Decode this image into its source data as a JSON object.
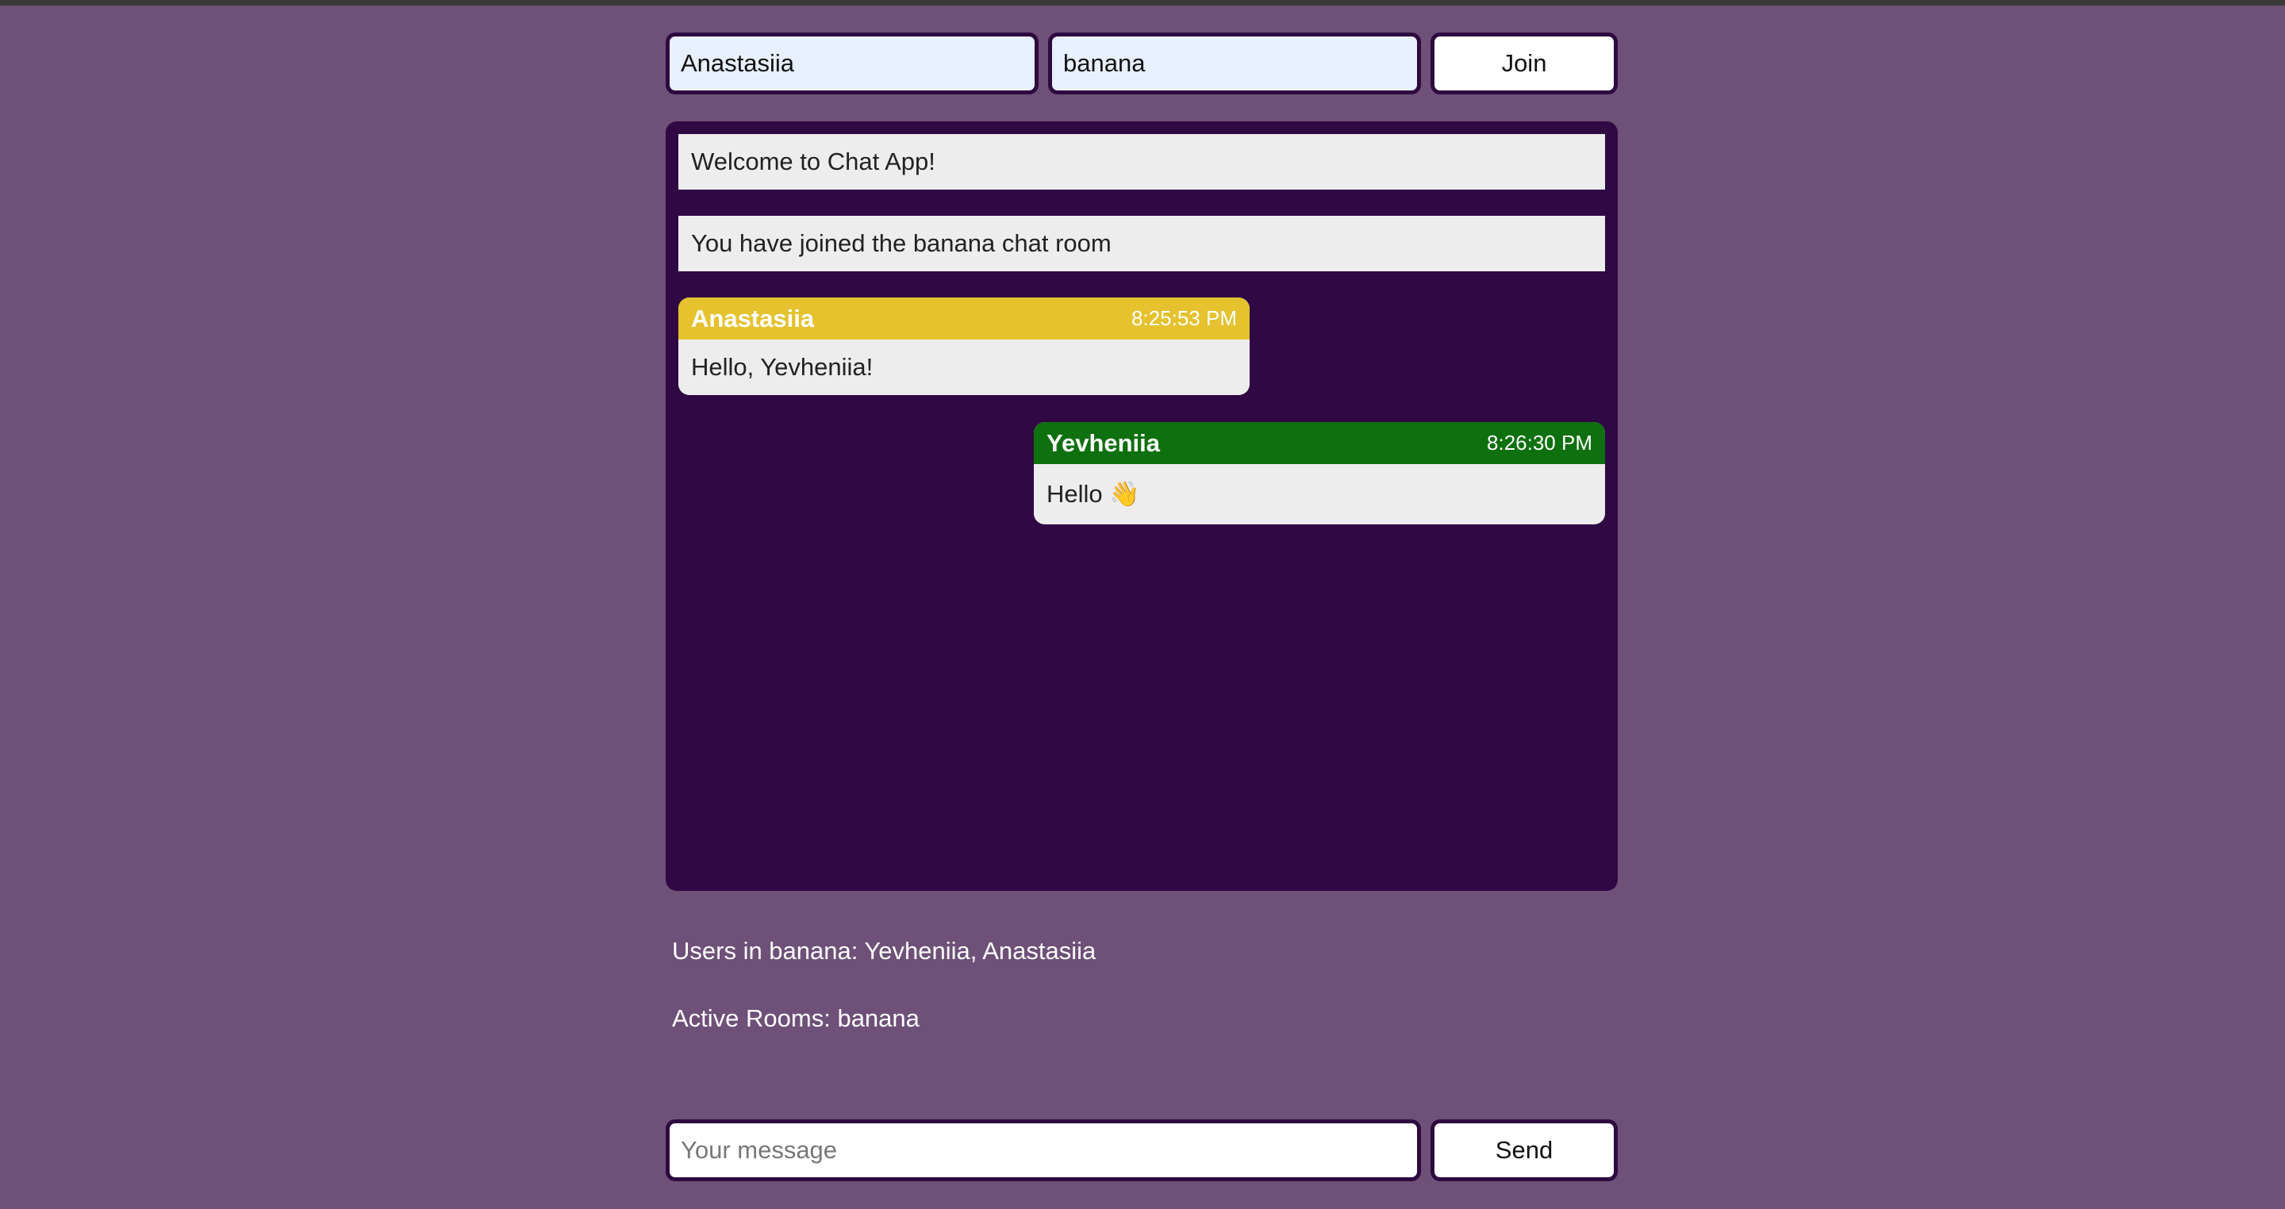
{
  "join_form": {
    "name_value": "Anastasiia",
    "room_value": "banana",
    "join_label": "Join"
  },
  "chat": {
    "system_messages": [
      "Welcome to Chat App!",
      "You have joined the banana chat room"
    ],
    "messages": [
      {
        "author": "Anastasiia",
        "time": "8:25:53 PM",
        "text": "Hello, Yevheniia!",
        "color": "#e5c22e",
        "side": "left"
      },
      {
        "author": "Yevheniia",
        "time": "8:26:30 PM",
        "text": "Hello 👋",
        "color": "#0e700e",
        "side": "right"
      }
    ]
  },
  "info": {
    "users_line": "Users in banana: Yevheniia, Anastasiia",
    "rooms_line": "Active Rooms: banana"
  },
  "send_form": {
    "message_placeholder": "Your message",
    "send_label": "Send"
  },
  "colors": {
    "page_background": "#6e5078",
    "chat_background": "#300843",
    "border": "#2d0a3f"
  }
}
